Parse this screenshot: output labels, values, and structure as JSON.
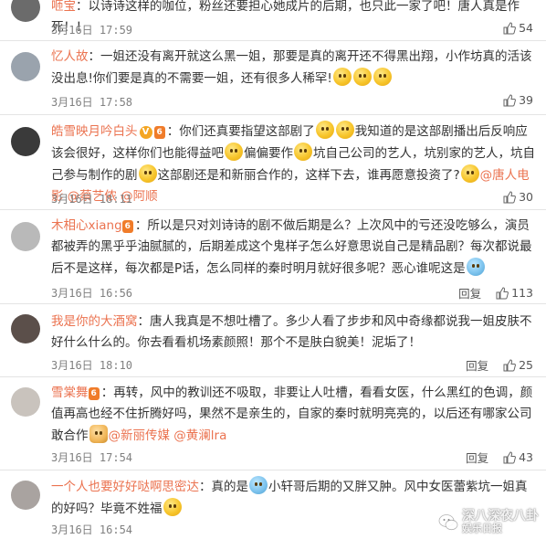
{
  "common": {
    "reply_label": "回复"
  },
  "comments": [
    {
      "user": "咂宝",
      "sep": "：",
      "text": "以诗诗这样的咖位，粉丝还要担心她成片的后期，也只此一家了吧！唐人真是作死！！",
      "time": "3月16日 17:59",
      "likes": "54",
      "avatar_color": "#6b6b6b"
    },
    {
      "user": "忆人故",
      "sep": "：",
      "text1": "一姐还没有离开就这么黑一姐，那要是真的离开还不得黑出翔，小作坊真的活该没出息!你们要是真的不需要一姐，还有很多人稀罕!",
      "time": "3月16日 17:58",
      "likes": "39",
      "avatar_color": "#9aa3ad"
    },
    {
      "user": "皓雪映月吟白头",
      "sep": "：",
      "text1": "你们还真要指望这部剧了",
      "text2": "我知道的是这部剧播出后反响应该会很好，这样你们也能得益吧",
      "text3": "偏偏要作",
      "text4": "坑自己公司的艺人，坑别家的艺人，坑自己参与制作的剧",
      "text5": "这部剧还是和新丽合作的，这样下去，谁再愿意投资了?",
      "mention1": "@唐人电影",
      "mention2": "@蔡艺侬",
      "mention3": "@阿顺",
      "time": "3月16日 18:11",
      "likes": "30",
      "avatar_color": "#3a3a3a"
    },
    {
      "user": "木相心xiang",
      "sep": "：",
      "text": "所以是只对刘诗诗的剧不做后期是么？上次风中的亏还没吃够么，演员都被弄的黑乎乎油腻腻的，后期差成这个鬼样子怎么好意思说自己是精品剧？每次都说最后不是这样，每次都是P话，怎么同样的秦时明月就好很多呢？恶心谁呢这是",
      "time": "3月16日 16:56",
      "likes": "113",
      "avatar_color": "#b9b9b9"
    },
    {
      "user": "我是你的大酒窝",
      "sep": "：",
      "text": "唐人我真是不想吐槽了。多少人看了步步和风中奇缘都说我一姐皮肤不好什么什么的。你去看看机场素颜照！那个不是肤白貌美！泥垢了！",
      "time": "3月16日 18:10",
      "likes": "25",
      "avatar_color": "#5b4f4a"
    },
    {
      "user": "雪棠舞",
      "sep": "：",
      "text1": "再转，风中的教训还不吸取，非要让人吐槽，看看女医，什么黑红的色调，颜值再高也经不住折腾好吗，果然不是亲生的，自家的秦时就明亮亮的，以后还有哪家公司敢合作",
      "mention1": "@新丽传媒",
      "mention2": "@黄澜lra",
      "time": "3月16日 17:54",
      "likes": "43",
      "avatar_color": "#c9c3bd"
    },
    {
      "user": "一个人也要好好哒啊思密达",
      "sep": "：",
      "text1": "真的是",
      "text2": "小轩哥后期的又胖又肿。风中女医蕾紫坑一姐真的好吗？毕竟不姓福",
      "time": "3月16日 16:54",
      "avatar_color": "#a9a3a0"
    }
  ],
  "watermark": {
    "line1": "深八深夜八卦",
    "line2": "娱乐日报"
  },
  "colors": {
    "username": "#eb7350",
    "meta": "#808080",
    "divider": "#e4e4e4"
  },
  "icons": [
    "thumb-up-icon",
    "emoji-smile-icon",
    "emoji-cold-sweat-icon",
    "emoji-doge-icon",
    "emoji-cry-icon",
    "verified-badge-icon",
    "vip-badge-icon",
    "wechat-logo-icon"
  ]
}
